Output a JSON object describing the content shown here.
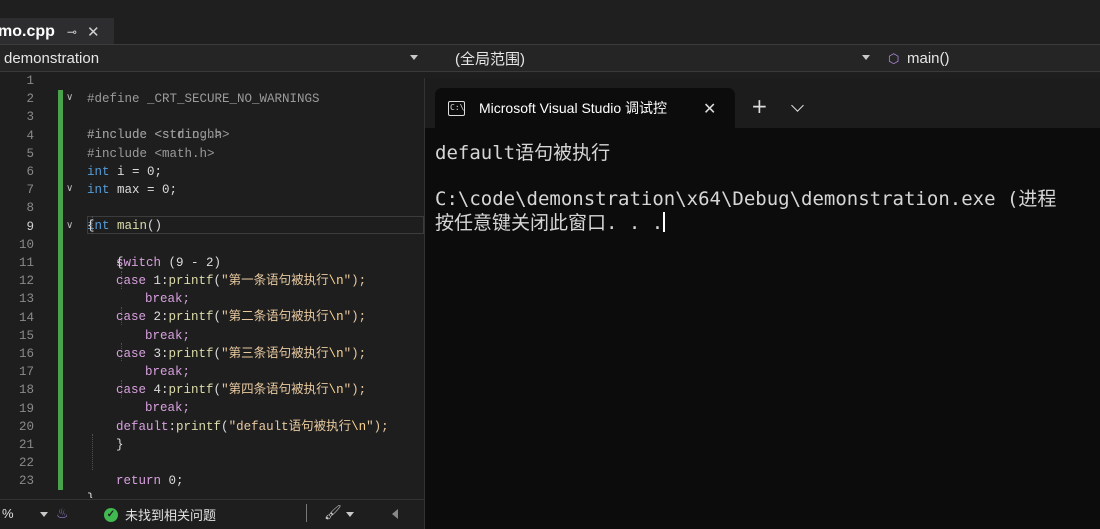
{
  "editor_tab": {
    "name": "mo.cpp",
    "pin_icon": "pin-icon",
    "close_icon": "close-icon"
  },
  "nav": {
    "project": "demonstration",
    "scope": "(全局范围)",
    "member": "main()"
  },
  "code_lines": [
    {
      "n": "1"
    },
    {
      "n": "2"
    },
    {
      "n": "3"
    },
    {
      "n": "4"
    },
    {
      "n": "5"
    },
    {
      "n": "6"
    },
    {
      "n": "7"
    },
    {
      "n": "8"
    },
    {
      "n": "9"
    },
    {
      "n": "10"
    },
    {
      "n": "11"
    },
    {
      "n": "12"
    },
    {
      "n": "13"
    },
    {
      "n": "14"
    },
    {
      "n": "15"
    },
    {
      "n": "16"
    },
    {
      "n": "17"
    },
    {
      "n": "18"
    },
    {
      "n": "19"
    },
    {
      "n": "20"
    },
    {
      "n": "21"
    },
    {
      "n": "22"
    },
    {
      "n": "23"
    }
  ],
  "code": {
    "l1": "#define _CRT_SECURE_NO_WARNINGS",
    "l2": "#include <stdio.h>",
    "l3": "#include <string.h>",
    "l4": "#include <math.h>",
    "l5_kw": "int",
    "l5_rest": " i = 0;",
    "l6_kw": "int",
    "l6_rest": " max = 0;",
    "l7_kw": "int",
    "l7_fn": " main",
    "l7_rest": "()",
    "l8": "{",
    "l9_kw": "switch",
    "l9_rest": " (9 - 2)",
    "l10": "{",
    "l11_kw": "case",
    "l11_pre": " 1:",
    "l11_fn": "printf",
    "l11_p": "(",
    "l11_str": "\"第一条语句被执行",
    "l11_esc": "\\n",
    "l11_end": "\");",
    "l12": "break;",
    "l13_kw": "case",
    "l13_pre": " 2:",
    "l13_fn": "printf",
    "l13_p": "(",
    "l13_str": "\"第二条语句被执行",
    "l13_esc": "\\n",
    "l13_end": "\");",
    "l14": "break;",
    "l15_kw": "case",
    "l15_pre": " 3:",
    "l15_fn": "printf",
    "l15_p": "(",
    "l15_str": "\"第三条语句被执行",
    "l15_esc": "\\n",
    "l15_end": "\");",
    "l16": "break;",
    "l17_kw": "case",
    "l17_pre": " 4:",
    "l17_fn": "printf",
    "l17_p": "(",
    "l17_str": "\"第四条语句被执行",
    "l17_esc": "\\n",
    "l17_end": "\");",
    "l18": "break;",
    "l19_kw": "default",
    "l19_pre": ":",
    "l19_fn": "printf",
    "l19_p": "(",
    "l19_str": "\"default语句被执行",
    "l19_esc": "\\n",
    "l19_end": "\");",
    "l20": "}",
    "l22_kw": "return",
    "l22_rest": " 0;",
    "l23": "}"
  },
  "status": {
    "zoom": "%",
    "issues": "未找到相关问题"
  },
  "terminal": {
    "title": "Microsoft Visual Studio 调试控",
    "line1": "default语句被执行",
    "line2": "C:\\code\\demonstration\\x64\\Debug\\demonstration.exe (进程",
    "line3": "按任意键关闭此窗口. . ."
  },
  "colors": {
    "accent_green": "#4aa24a",
    "keyword": "#569cd6",
    "control": "#d8a0df",
    "function": "#dcdcaa",
    "string": "#e8c9a0"
  }
}
